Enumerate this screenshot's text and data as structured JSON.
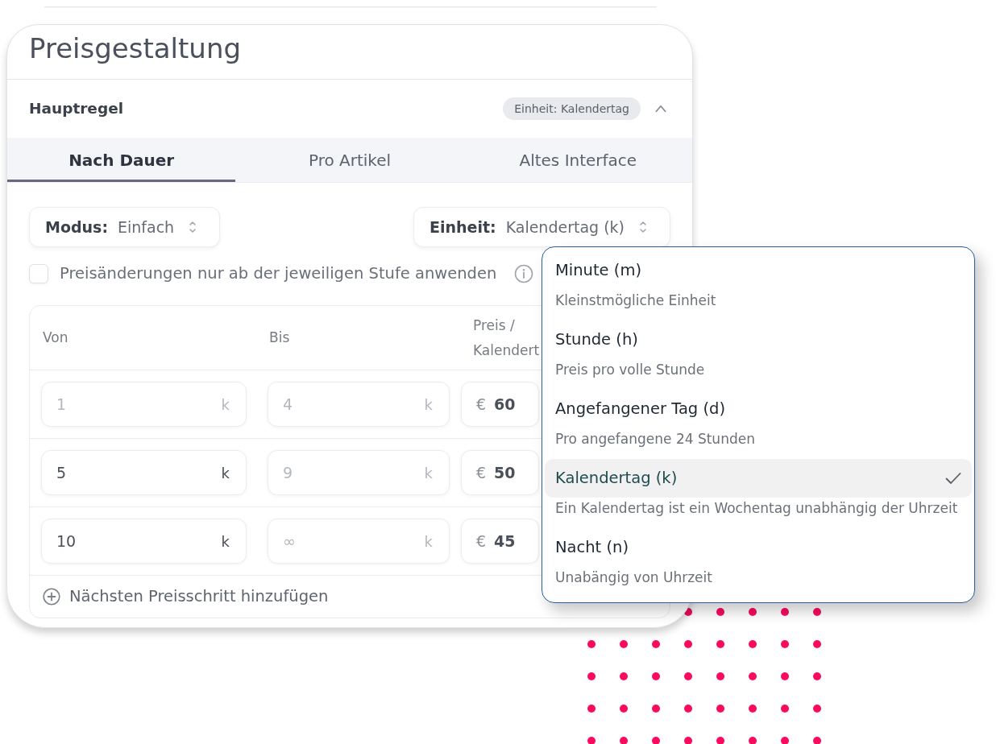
{
  "background_card": {
    "title": "Preisgestaltung",
    "rule": {
      "title": "Hauptregel",
      "badge": "Einheit: Kalendertag",
      "expanded": true
    },
    "tabs": [
      {
        "label": "Nach Dauer",
        "selected": true
      },
      {
        "label": "Pro Artikel",
        "selected": false
      },
      {
        "label": "Altes Interface",
        "selected": false
      }
    ],
    "selects": [
      {
        "label": "Modus:",
        "value": "Einfach"
      },
      {
        "label": "Einheit:",
        "value": "Kalendertag (k)"
      }
    ],
    "checkbox": {
      "label": "Preisänderungen nur ab der jeweiligen Stufe anwenden",
      "checked": false
    },
    "price_table": {
      "columns": [
        "Von",
        "Bis",
        "Preis / Kalendert"
      ],
      "rows": [
        {
          "from": {
            "value": "1",
            "unit": "k",
            "disabled": true
          },
          "to": {
            "value": "4",
            "unit": "k",
            "disabled": true
          },
          "price": {
            "currency": "€",
            "value": "60"
          }
        },
        {
          "from": {
            "value": "5",
            "unit": "k",
            "disabled": false
          },
          "to": {
            "value": "9",
            "unit": "k",
            "disabled": true
          },
          "price": {
            "currency": "€",
            "value": "50"
          }
        },
        {
          "from": {
            "value": "10",
            "unit": "k",
            "disabled": false
          },
          "to": {
            "value": "∞",
            "unit": "k",
            "disabled": true
          },
          "price": {
            "currency": "€",
            "value": "45"
          }
        }
      ],
      "add_step": "Nächsten Preisschritt hinzufügen"
    }
  },
  "unit_dropdown": {
    "options": [
      {
        "label": "Minute (m)",
        "description": "Kleinstmögliche Einheit",
        "selected": false
      },
      {
        "label": "Stunde (h)",
        "description": "Preis pro volle Stunde",
        "selected": false
      },
      {
        "label": "Angefangener Tag (d)",
        "description": "Pro angefangene 24 Stunden",
        "selected": false
      },
      {
        "label": "Kalendertag (k)",
        "description": "Ein Kalendertag ist ein Wochentag unabhängig der Uhrzeit",
        "selected": true
      },
      {
        "label": "Nacht (n)",
        "description": "Unabängig von Uhrzeit",
        "selected": false
      }
    ]
  }
}
